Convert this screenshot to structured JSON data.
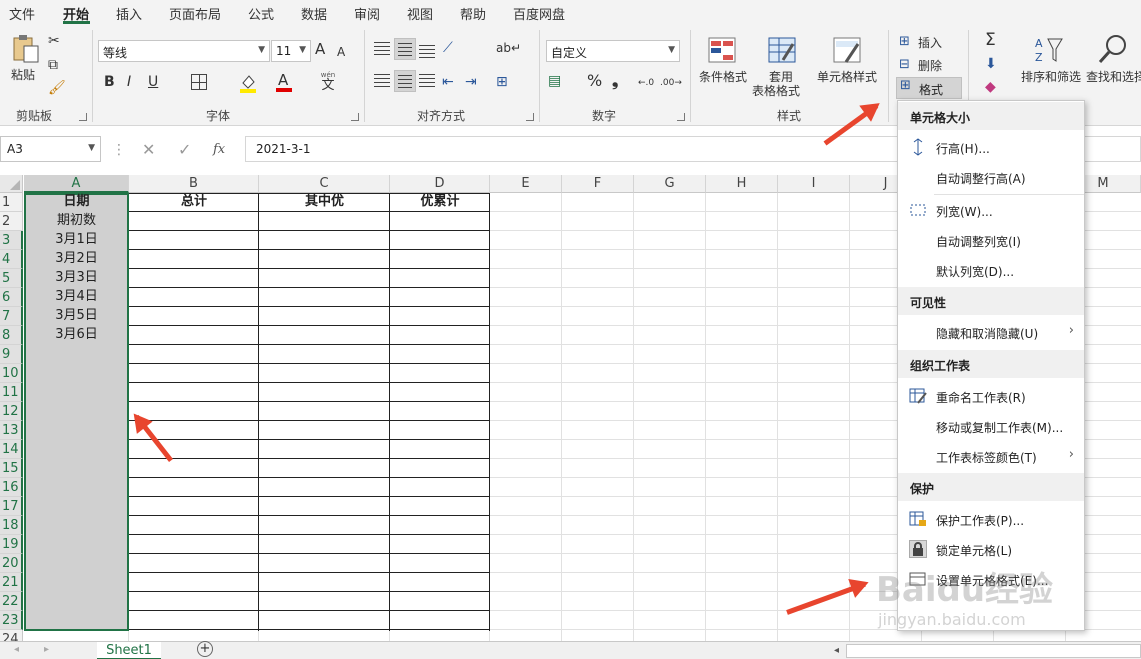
{
  "menu": {
    "tabs": [
      "文件",
      "开始",
      "插入",
      "页面布局",
      "公式",
      "数据",
      "审阅",
      "视图",
      "帮助",
      "百度网盘"
    ],
    "active": "开始"
  },
  "ribbon": {
    "clipboard": {
      "paste": "粘贴",
      "label": "剪贴板"
    },
    "font": {
      "name": "等线",
      "size": "11",
      "label": "字体",
      "bold": "B",
      "italic": "I",
      "underline": "U",
      "grow": "A",
      "shrink": "A",
      "color_letter": "A",
      "wen": "wén",
      "wen_char": "文"
    },
    "align": {
      "label": "对齐方式"
    },
    "number": {
      "format": "自定义",
      "label": "数字",
      "percent": "%",
      "comma": "❟"
    },
    "styles": {
      "conditional": "条件格式",
      "table1": "套用",
      "table2": "表格格式",
      "cellstyle": "单元格样式",
      "label": "样式"
    },
    "cells": {
      "insert": "插入",
      "delete": "删除",
      "format": "格式"
    },
    "editing": {
      "sort": "排序和筛选",
      "find": "查找和选择"
    }
  },
  "formula": {
    "namebox": "A3",
    "fx": "fx",
    "value": "2021-3-1"
  },
  "columns": [
    "A",
    "B",
    "C",
    "D",
    "E",
    "F",
    "G",
    "H",
    "I",
    "J",
    "M"
  ],
  "rows": [
    "1",
    "2",
    "3",
    "4",
    "5",
    "6",
    "7",
    "8",
    "9",
    "10",
    "11",
    "12",
    "13",
    "14",
    "15",
    "16",
    "17",
    "18",
    "19",
    "20",
    "21",
    "22",
    "23",
    "24"
  ],
  "cells": {
    "A1": "日期",
    "B1": "总计",
    "C1": "其中优",
    "D1": "优累计",
    "A2": "期初数",
    "A3": "3月1日",
    "A4": "3月2日",
    "A5": "3月3日",
    "A6": "3月4日",
    "A7": "3月5日",
    "A8": "3月6日"
  },
  "sheet": {
    "tab": "Sheet1",
    "add": "+"
  },
  "format_menu": {
    "sec1": "单元格大小",
    "row_height": "行高(H)...",
    "autofit_row": "自动调整行高(A)",
    "col_width": "列宽(W)...",
    "autofit_col": "自动调整列宽(I)",
    "default_width": "默认列宽(D)...",
    "sec2": "可见性",
    "hide_unhide": "隐藏和取消隐藏(U)",
    "sec3": "组织工作表",
    "rename": "重命名工作表(R)",
    "move_copy": "移动或复制工作表(M)...",
    "tab_color": "工作表标签颜色(T)",
    "sec4": "保护",
    "protect": "保护工作表(P)...",
    "lock": "锁定单元格(L)",
    "format_cells": "设置单元格格式(E)..."
  },
  "watermark": {
    "brand": "Baidu经验",
    "url": "jingyan.baidu.com"
  },
  "colors": {
    "excel_green": "#217346",
    "arrow_red": "#e8452e",
    "selection_gray": "#d0d0d0"
  }
}
